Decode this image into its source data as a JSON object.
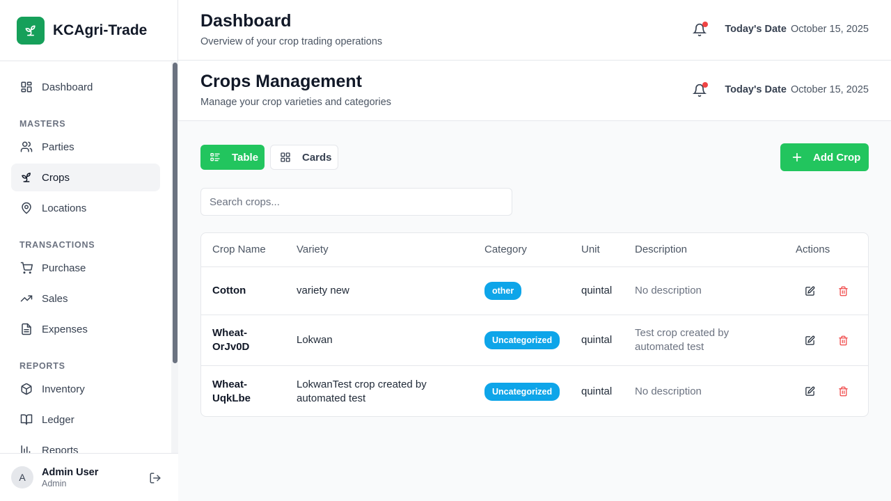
{
  "brand": {
    "name": "KCAgri-Trade"
  },
  "sidebar": {
    "dashboard": "Dashboard",
    "sections": {
      "masters": "MASTERS",
      "transactions": "TRANSACTIONS",
      "reports": "REPORTS"
    },
    "items": {
      "parties": "Parties",
      "crops": "Crops",
      "locations": "Locations",
      "purchase": "Purchase",
      "sales": "Sales",
      "expenses": "Expenses",
      "inventory": "Inventory",
      "ledger": "Ledger",
      "reports": "Reports"
    },
    "active": "Crops"
  },
  "user": {
    "initial": "A",
    "name": "Admin User",
    "role": "Admin"
  },
  "header_top": {
    "title": "Dashboard",
    "subtitle": "Overview of your crop trading operations",
    "date_label": "Today's Date",
    "date_value": "October 15, 2025"
  },
  "header_page": {
    "title": "Crops Management",
    "subtitle": "Manage your crop varieties and categories",
    "date_label": "Today's Date",
    "date_value": "October 15, 2025"
  },
  "toolbar": {
    "view_table": "Table",
    "view_cards": "Cards",
    "active_view": "Table",
    "add_label": "Add Crop"
  },
  "search": {
    "placeholder": "Search crops...",
    "value": ""
  },
  "table": {
    "headers": {
      "name": "Crop Name",
      "variety": "Variety",
      "category": "Category",
      "unit": "Unit",
      "description": "Description",
      "actions": "Actions"
    },
    "rows": [
      {
        "name": "Cotton",
        "variety": "variety new",
        "category": "other",
        "unit": "quintal",
        "description": "No description"
      },
      {
        "name": "Wheat-OrJv0D",
        "variety": "Lokwan",
        "category": "Uncategorized",
        "unit": "quintal",
        "description": "Test crop created by automated test"
      },
      {
        "name": "Wheat-UqkLbe",
        "variety": "LokwanTest crop created by automated test",
        "category": "Uncategorized",
        "unit": "quintal",
        "description": "No description"
      }
    ]
  },
  "colors": {
    "brand": "#16a05a",
    "primary_button": "#22c55e",
    "badge": "#0ea5e9",
    "notification_dot": "#ef4444",
    "delete_icon": "#ef4444"
  },
  "icons": {
    "brand": "sprout-icon",
    "dashboard": "layout-grid-icon",
    "parties": "users-icon",
    "crops": "sprout-icon",
    "locations": "map-pin-icon",
    "purchase": "shopping-cart-icon",
    "sales": "trending-up-icon",
    "expenses": "file-text-icon",
    "inventory": "package-icon",
    "ledger": "book-open-icon",
    "logout": "logout-icon",
    "notifications": "bell-icon",
    "edit": "edit-icon",
    "delete": "trash-icon"
  }
}
